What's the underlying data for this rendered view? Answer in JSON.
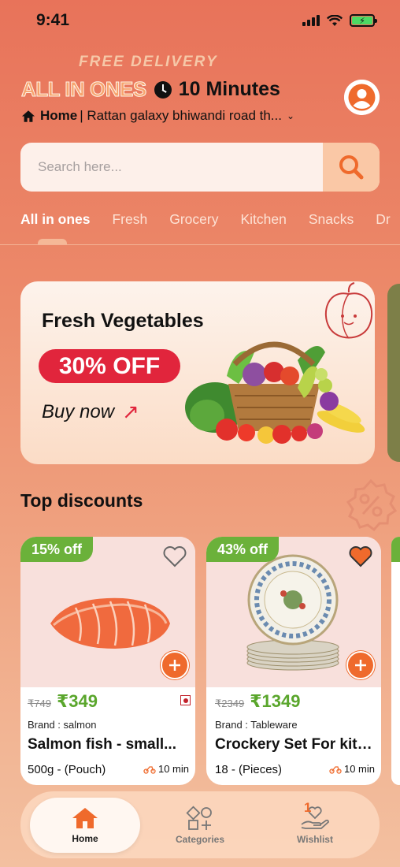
{
  "status": {
    "time": "9:41"
  },
  "header": {
    "promo": "FREE DELIVERY",
    "brand": "ALL IN ONES",
    "eta": "10 Minutes",
    "address_label": "Home",
    "address_text": "| Rattan galaxy bhiwandi road th..."
  },
  "search": {
    "placeholder": "Search here..."
  },
  "tabs": [
    {
      "label": "All in ones"
    },
    {
      "label": "Fresh"
    },
    {
      "label": "Grocery"
    },
    {
      "label": "Kitchen"
    },
    {
      "label": "Snacks"
    },
    {
      "label": "Dr"
    }
  ],
  "banner": {
    "title": "Fresh Vegetables",
    "offer": "30% OFF",
    "cta": "Buy now"
  },
  "section": {
    "title": "Top discounts"
  },
  "products": [
    {
      "discount": "15% off",
      "mrp": "₹749",
      "price": "₹349",
      "brand": "Brand : salmon",
      "title": "Salmon fish - small...",
      "qty": "500g - (Pouch)",
      "time": "10 min",
      "wishlisted": false
    },
    {
      "discount": "43% off",
      "mrp": "₹2349",
      "price": "₹1349",
      "brand": "Brand : Tableware",
      "title": "Crockery Set For kitc...",
      "qty": "18 - (Pieces)",
      "time": "10 min",
      "wishlisted": true
    }
  ],
  "nav": {
    "home": "Home",
    "categories": "Categories",
    "wishlist": "Wishlist",
    "wishlist_count": "1"
  },
  "colors": {
    "accent": "#ef6a2c",
    "discount_green": "#6bb13a",
    "offer_red": "#e1253c"
  }
}
